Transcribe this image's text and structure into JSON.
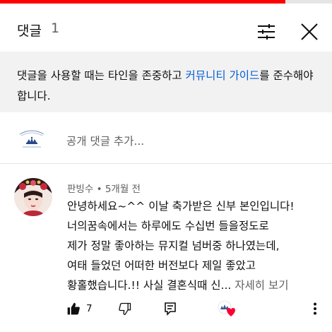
{
  "video_progress": {
    "fraction": 0.86,
    "color": "#ff0000"
  },
  "header": {
    "title": "댓글",
    "count": "1"
  },
  "notice": {
    "text_before": "댓글을 사용할 때는 타인을 존중하고 ",
    "link": "커뮤니티 가이드",
    "text_after": "를 준수해야 합니다.",
    "link_color": "#065fd4"
  },
  "compose": {
    "placeholder": "공개 댓글 추가...",
    "avatar_icon": "channel-logo-icon"
  },
  "comment": {
    "author": "판빙수",
    "separator": "•",
    "time": "5개월 전",
    "lines": [
      "안녕하세요~^^ 이날 축가받은 신부 본인입니다!",
      "너의꿈속에서는 하루에도 수십번 들을정도로",
      "제가 정말 좋아하는 뮤지컬 넘버중 하나였는데,",
      "여태 들었던 어떠한 버전보다 제일 좋았고",
      "황홀했습니다.!! 사실 결혼식때 신..."
    ],
    "read_more": "자세히 보기",
    "likes": "7",
    "heart_color": "#ff0033"
  }
}
